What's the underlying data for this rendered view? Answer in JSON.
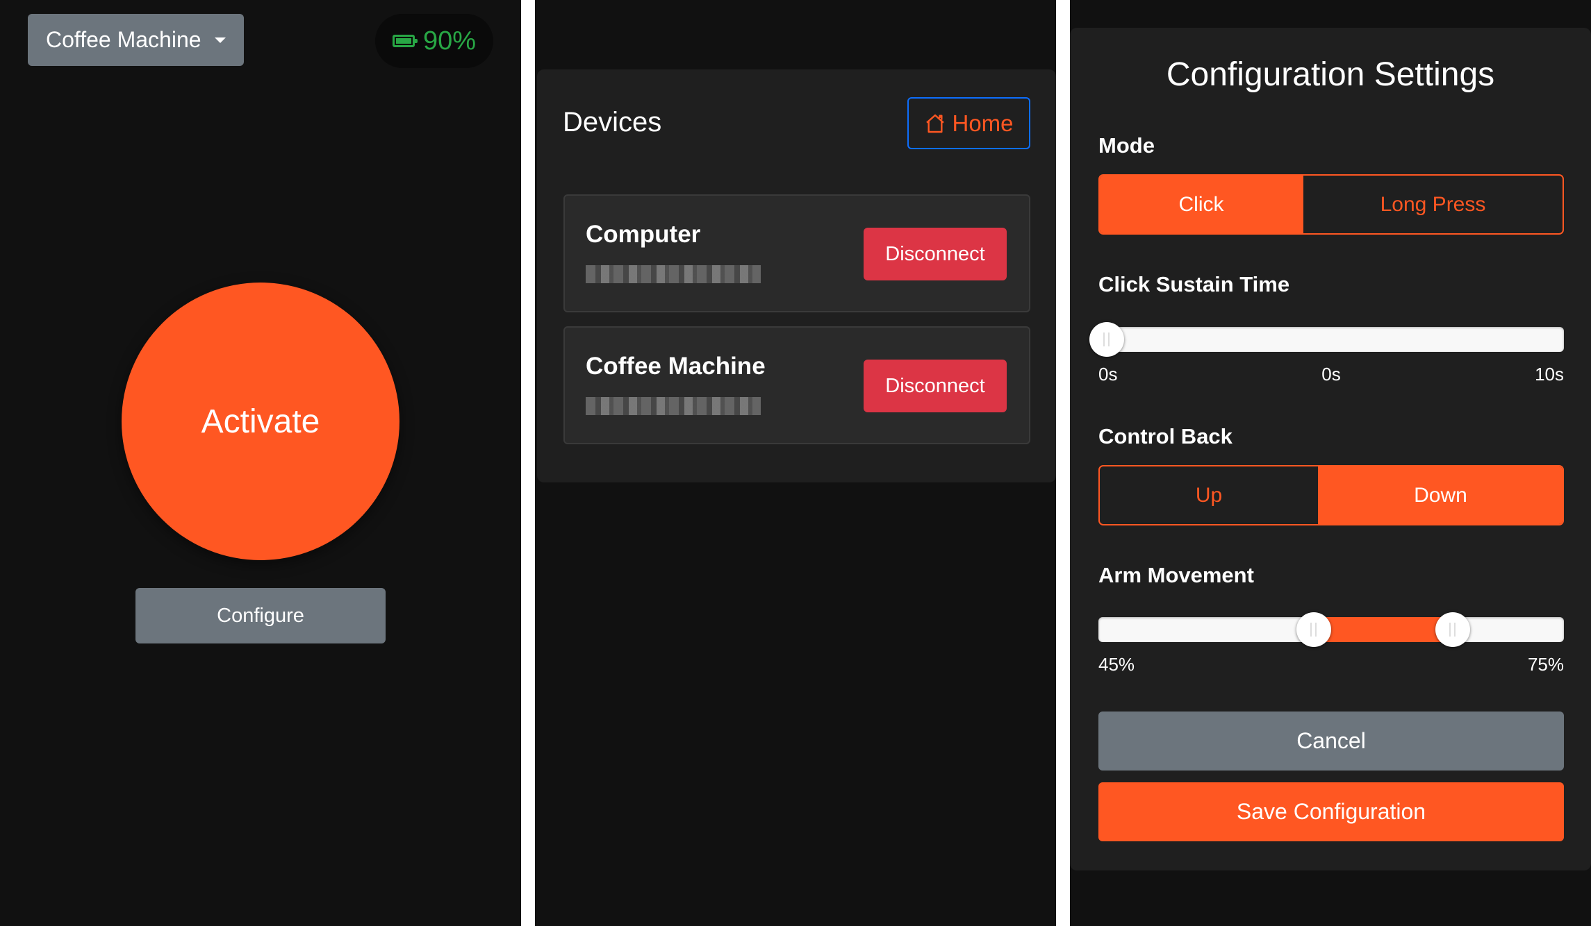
{
  "home_screen": {
    "device_select": {
      "selected": "Coffee Machine"
    },
    "battery": {
      "level_text": "90%",
      "level_fraction": 0.9,
      "color": "#28a745"
    },
    "activate_label": "Activate",
    "configure_label": "Configure"
  },
  "devices_screen": {
    "title": "Devices",
    "home_label": "Home",
    "devices": [
      {
        "name": "Computer",
        "disconnect_label": "Disconnect"
      },
      {
        "name": "Coffee Machine",
        "disconnect_label": "Disconnect"
      }
    ]
  },
  "config_screen": {
    "title": "Configuration Settings",
    "mode": {
      "label": "Mode",
      "options": [
        "Click",
        "Long Press"
      ],
      "selected": "Click"
    },
    "click_sustain": {
      "label": "Click Sustain Time",
      "value_text": "0s",
      "value": 0,
      "min_label": "0s",
      "max_label": "10s",
      "min": 0,
      "max": 10
    },
    "control_back": {
      "label": "Control Back",
      "options": [
        "Up",
        "Down"
      ],
      "selected": "Down"
    },
    "arm_movement": {
      "label": "Arm Movement",
      "low_text": "45%",
      "high_text": "75%",
      "low": 45,
      "high": 75
    },
    "cancel_label": "Cancel",
    "save_label": "Save Configuration"
  },
  "colors": {
    "accent": "#ff5722",
    "danger": "#dc3545",
    "secondary": "#6c757d",
    "background": "#111111",
    "card": "#1f1f1f",
    "home_border": "#0d6efd"
  }
}
